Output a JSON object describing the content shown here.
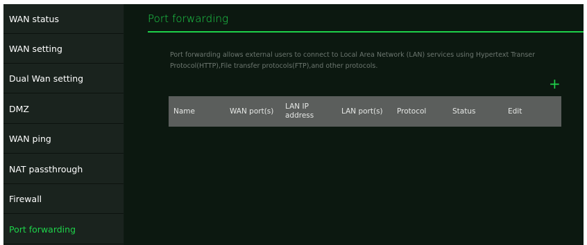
{
  "sidebar": {
    "items": [
      {
        "label": "WAN status"
      },
      {
        "label": "WAN setting"
      },
      {
        "label": "Dual Wan setting"
      },
      {
        "label": "DMZ"
      },
      {
        "label": "WAN ping"
      },
      {
        "label": "NAT passthrough"
      },
      {
        "label": "Firewall"
      },
      {
        "label": "Port forwarding",
        "active": true
      }
    ]
  },
  "main": {
    "title": "Port forwarding",
    "description": "Port forwarding allows external users to connect to Local Area Network (LAN) services using Hypertext Transer Protocol(HTTP),File transfer protocols(FTP),and other protocols.",
    "add_icon": "plus-icon",
    "table": {
      "columns": [
        "Name",
        "WAN port(s)",
        "LAN IP address",
        "LAN port(s)",
        "Protocol",
        "Status",
        "Edit"
      ],
      "rows": []
    }
  },
  "colors": {
    "accent": "#1ed24a",
    "sidebar_bg": "#1a231e",
    "main_bg": "#0c1810",
    "table_header_bg": "#5b5e5c",
    "description_text": "#6d7770"
  }
}
